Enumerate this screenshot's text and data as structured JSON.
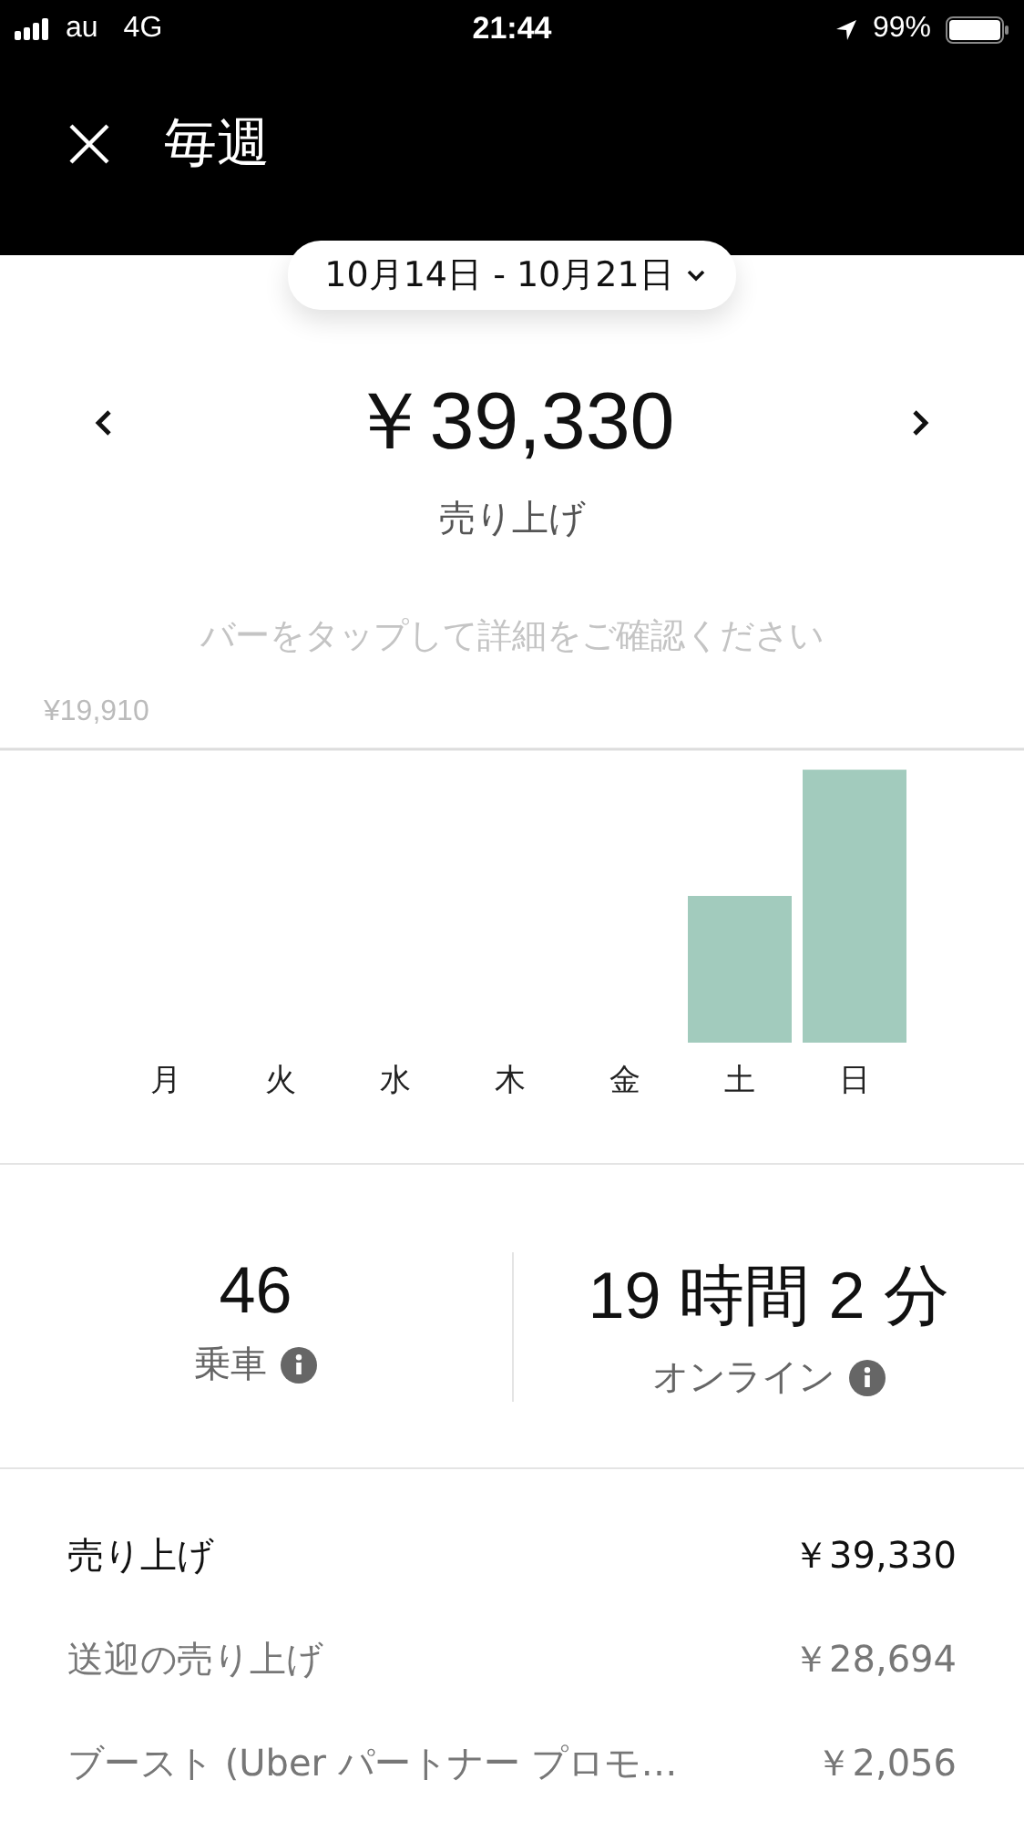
{
  "status_bar": {
    "carrier": "au",
    "network": "4G",
    "time": "21:44",
    "battery_percent": "99%"
  },
  "header": {
    "title": "毎週"
  },
  "date_range": {
    "label": "10月14日 - 10月21日"
  },
  "summary": {
    "amount": "￥39,330",
    "label": "売り上げ"
  },
  "hint": "バーをタップして詳細をご確認ください",
  "chart": {
    "max_label": "¥19,910",
    "days": [
      "月",
      "火",
      "水",
      "木",
      "金",
      "土",
      "日"
    ]
  },
  "stats": [
    {
      "value": "46",
      "label": "乗車"
    },
    {
      "value": "19 時間 2 分",
      "label": "オンライン"
    }
  ],
  "breakdown": [
    {
      "label": "売り上げ",
      "amount": "￥39,330",
      "kind": "total"
    },
    {
      "label": "送迎の売り上げ",
      "amount": "￥28,694",
      "kind": "item"
    },
    {
      "label": "ブースト (Uber パートナー プロモ…",
      "amount": "￥2,056",
      "kind": "item"
    }
  ]
}
